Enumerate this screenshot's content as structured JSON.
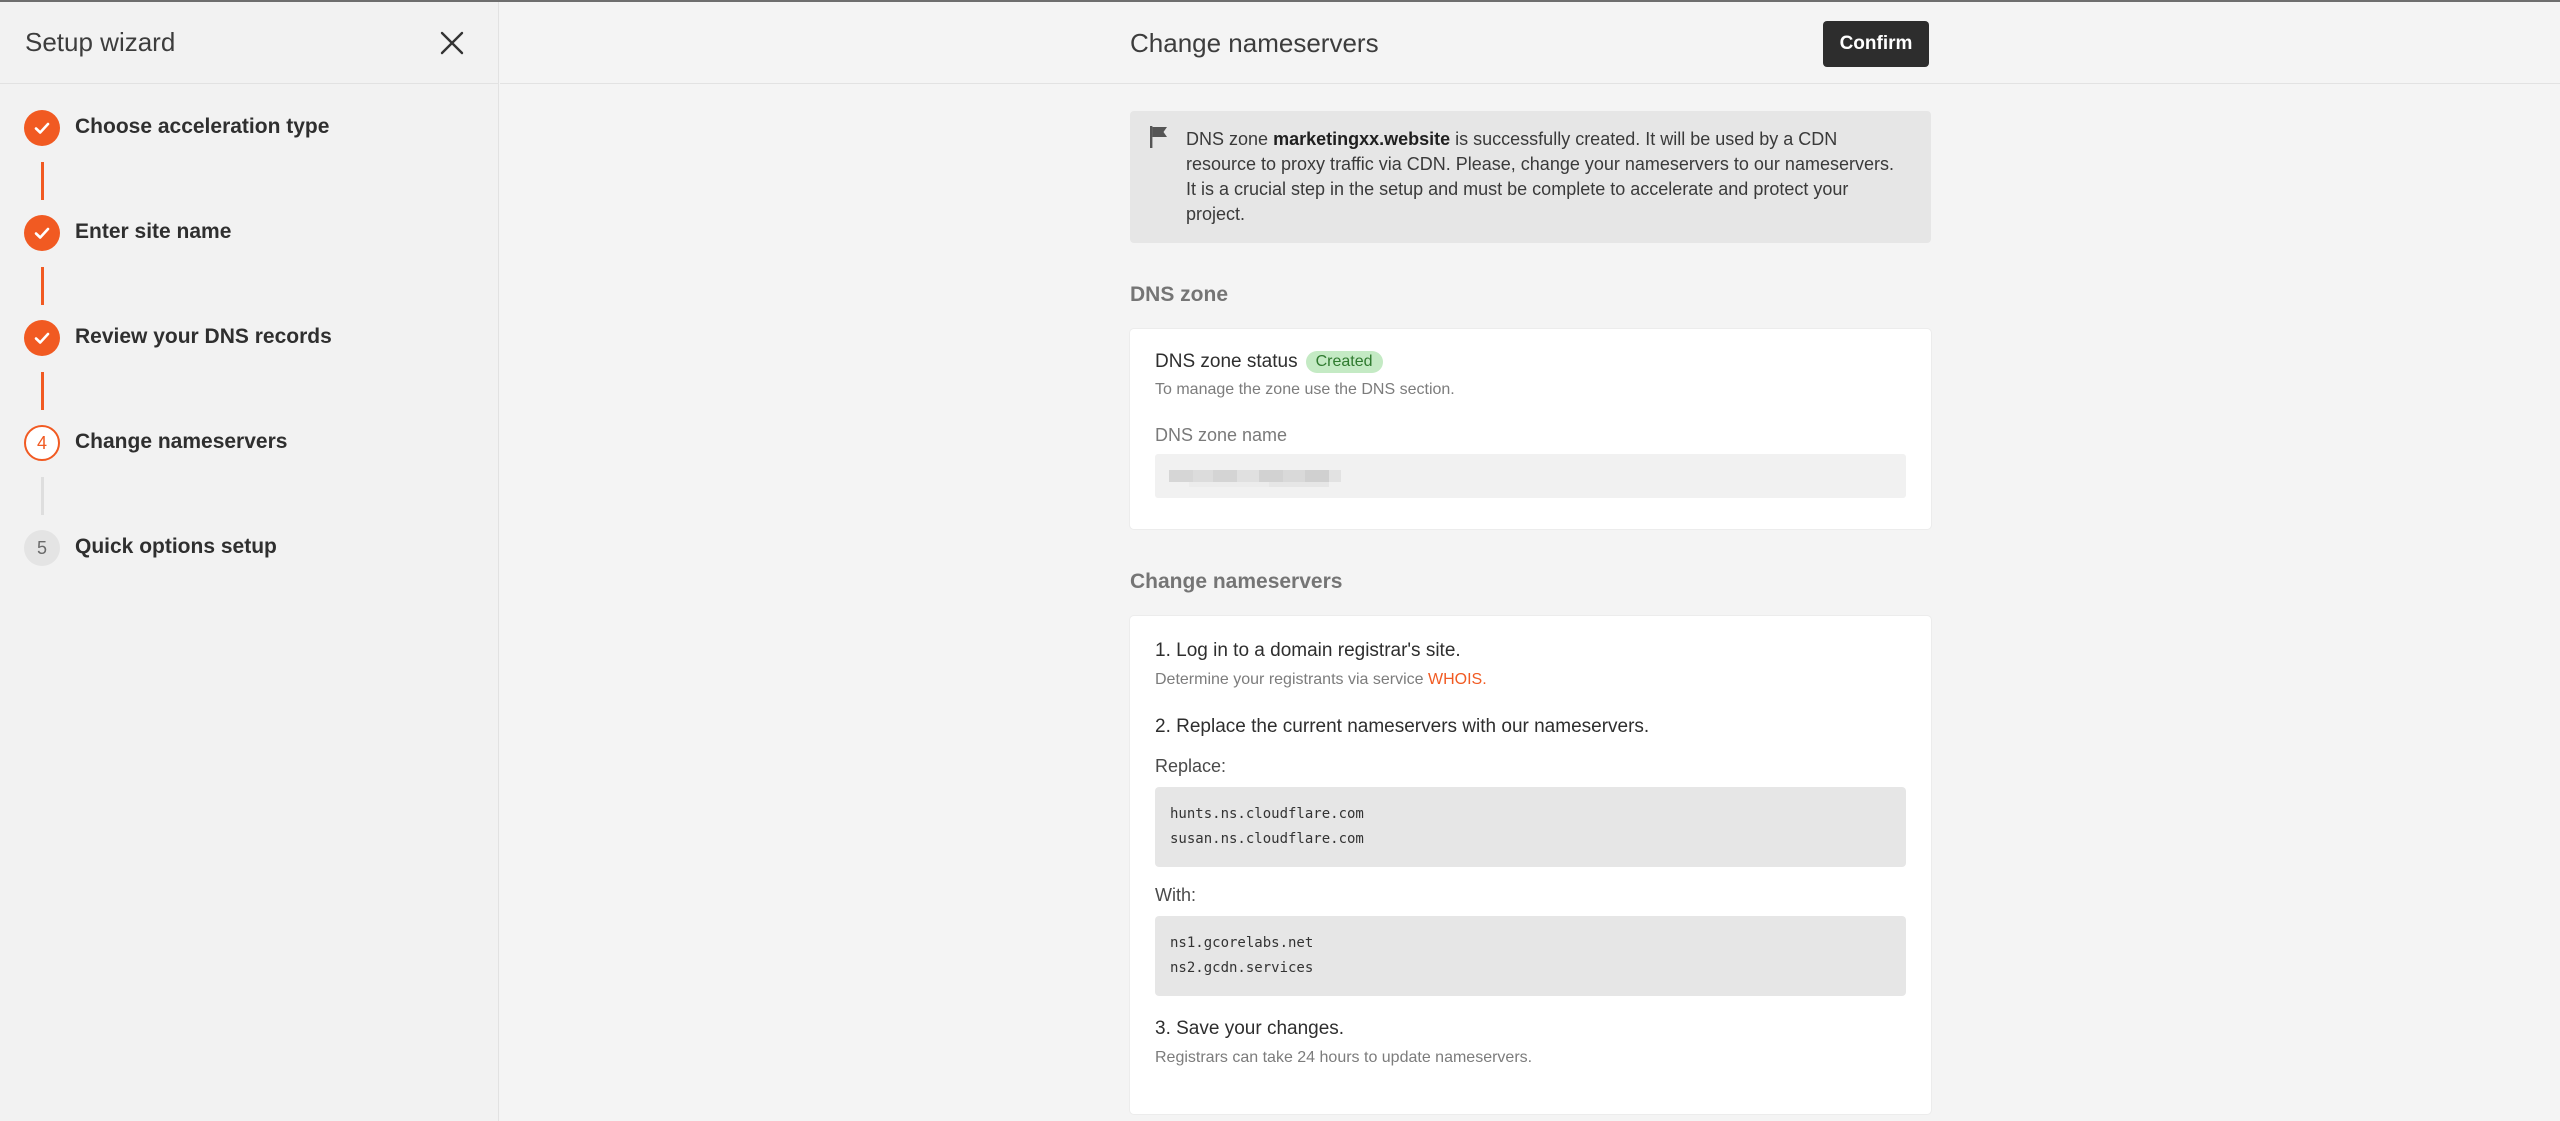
{
  "sidebar": {
    "title": "Setup wizard",
    "steps": [
      {
        "number": "1",
        "label": "Choose acceleration type",
        "state": "done"
      },
      {
        "number": "2",
        "label": "Enter site name",
        "state": "done"
      },
      {
        "number": "3",
        "label": "Review your DNS records",
        "state": "done"
      },
      {
        "number": "4",
        "label": "Change nameservers",
        "state": "active"
      },
      {
        "number": "5",
        "label": "Quick options setup",
        "state": "todo"
      }
    ]
  },
  "header": {
    "title": "Change nameservers",
    "confirm_label": "Confirm"
  },
  "notice": {
    "prefix": "DNS zone",
    "zone": "marketingxx.website",
    "suffix": "is successfully created. It will be used by a CDN resource to proxy traffic via CDN. Please, change your nameservers to our nameservers. It is a crucial step in the setup and must be complete to accelerate and protect your project."
  },
  "dns_zone": {
    "section_title": "DNS zone",
    "status_label": "DNS zone status",
    "status_badge": "Created",
    "hint": "To manage the zone use the DNS section.",
    "name_label": "DNS zone name",
    "name_value": ""
  },
  "nameservers": {
    "section_title": "Change nameservers",
    "step1": "1. Log in to a domain registrar's site.",
    "step1_hint_prefix": "Determine your registrants via service",
    "step1_link": "WHOIS",
    "step1_hint_suffix": ".",
    "step2": "2. Replace the current nameservers with our nameservers.",
    "replace_label": "Replace:",
    "replace_values": [
      "hunts.ns.cloudflare.com",
      "susan.ns.cloudflare.com"
    ],
    "with_label": "With:",
    "with_values": [
      "ns1.gcorelabs.net",
      "ns2.gcdn.services"
    ],
    "step3": "3. Save your changes.",
    "step3_hint": "Registrars can take 24 hours to update nameservers."
  },
  "colors": {
    "accent": "#f15a22",
    "badge_bg": "#c4eac4",
    "badge_text": "#2f7a2f",
    "button_bg": "#2d2d2d"
  }
}
